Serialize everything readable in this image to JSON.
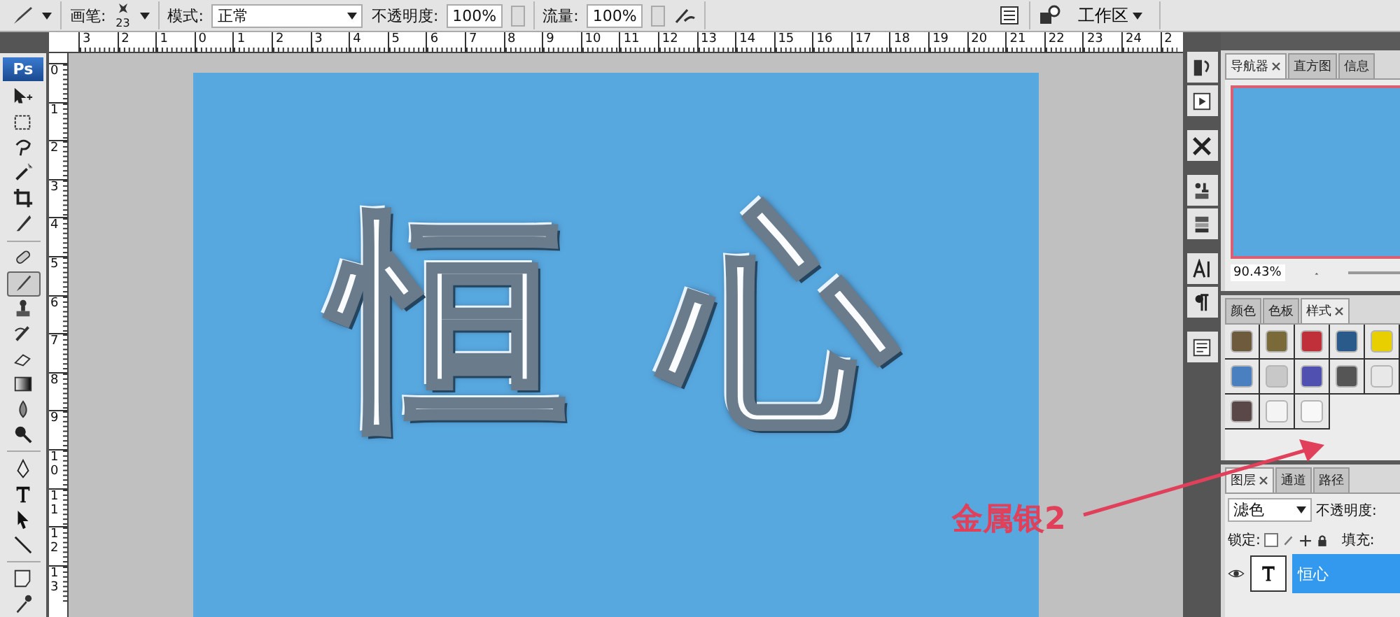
{
  "options_bar": {
    "brush_label": "画笔:",
    "brush_size": "23",
    "mode_label": "模式:",
    "mode_value": "正常",
    "opacity_label": "不透明度:",
    "opacity_value": "100%",
    "flow_label": "流量:",
    "flow_value": "100%",
    "workspace_label": "工作区"
  },
  "ruler_h": [
    "3",
    "2",
    "1",
    "0",
    "1",
    "2",
    "3",
    "4",
    "5",
    "6",
    "7",
    "8",
    "9",
    "10",
    "11",
    "12",
    "13",
    "14",
    "15",
    "16",
    "17",
    "18",
    "19",
    "20",
    "21",
    "22",
    "23",
    "24",
    "2"
  ],
  "ruler_v": [
    "0",
    "1",
    "2",
    "3",
    "4",
    "5",
    "6",
    "7",
    "8",
    "9",
    "10",
    "11",
    "12",
    "13"
  ],
  "toolbox": {
    "logo": "Ps",
    "tools": [
      {
        "kind": "move",
        "selected": false
      },
      {
        "kind": "marquee",
        "selected": false
      },
      {
        "kind": "lasso",
        "selected": false
      },
      {
        "kind": "wand",
        "selected": false
      },
      {
        "kind": "crop",
        "selected": false
      },
      {
        "kind": "slice",
        "selected": false
      },
      {
        "kind": "sep"
      },
      {
        "kind": "heal",
        "selected": false
      },
      {
        "kind": "brush",
        "selected": true
      },
      {
        "kind": "stamp",
        "selected": false
      },
      {
        "kind": "history",
        "selected": false
      },
      {
        "kind": "eraser",
        "selected": false
      },
      {
        "kind": "gradient",
        "selected": false
      },
      {
        "kind": "blur",
        "selected": false
      },
      {
        "kind": "dodge",
        "selected": false
      },
      {
        "kind": "sep"
      },
      {
        "kind": "pen",
        "selected": false
      },
      {
        "kind": "type",
        "selected": false
      },
      {
        "kind": "select",
        "selected": false
      },
      {
        "kind": "line",
        "selected": false
      },
      {
        "kind": "sep"
      },
      {
        "kind": "note",
        "selected": false
      },
      {
        "kind": "eyedropper",
        "selected": false
      }
    ]
  },
  "document": {
    "text": "恒心"
  },
  "dock": [
    {
      "kind": "history"
    },
    {
      "kind": "actions"
    },
    {
      "kind": "sep"
    },
    {
      "kind": "tools"
    },
    {
      "kind": "sep"
    },
    {
      "kind": "clone"
    },
    {
      "kind": "comps"
    },
    {
      "kind": "sep"
    },
    {
      "kind": "character"
    },
    {
      "kind": "paragraph"
    },
    {
      "kind": "sep"
    },
    {
      "kind": "notes"
    }
  ],
  "navigator": {
    "tabs": [
      {
        "label": "导航器",
        "selected": true
      },
      {
        "label": "直方图",
        "selected": false
      },
      {
        "label": "信息",
        "selected": false
      }
    ],
    "zoom": "90.43%"
  },
  "styles_panel": {
    "tabs": [
      {
        "label": "颜色",
        "selected": false
      },
      {
        "label": "色板",
        "selected": false
      },
      {
        "label": "样式",
        "selected": true
      }
    ],
    "swatches": [
      {
        "color": "#6e5a3c"
      },
      {
        "color": "#7a6a3a"
      },
      {
        "color": "#c0303a"
      },
      {
        "color": "#2a5a8a"
      },
      {
        "color": "#e8d000"
      },
      {
        "color": "#4a80c0"
      },
      {
        "color": "#c8c8c8"
      },
      {
        "color": "#5050b0"
      },
      {
        "color": "#555555"
      },
      {
        "color": "#e8e8e8"
      },
      {
        "color": "#5a4848"
      },
      {
        "color": "#f4f4f4"
      },
      {
        "color": "#f8f8f8"
      }
    ]
  },
  "layers_panel": {
    "tabs": [
      {
        "label": "图层",
        "selected": true
      },
      {
        "label": "通道",
        "selected": false
      },
      {
        "label": "路径",
        "selected": false
      }
    ],
    "blend_mode": "滤色",
    "opacity_label": "不透明度:",
    "lock_label": "锁定:",
    "fill_label": "填充:",
    "layers": [
      {
        "name": "恒心",
        "kind": "text",
        "selected": true
      }
    ]
  },
  "annotation": {
    "label": "金属银2"
  }
}
